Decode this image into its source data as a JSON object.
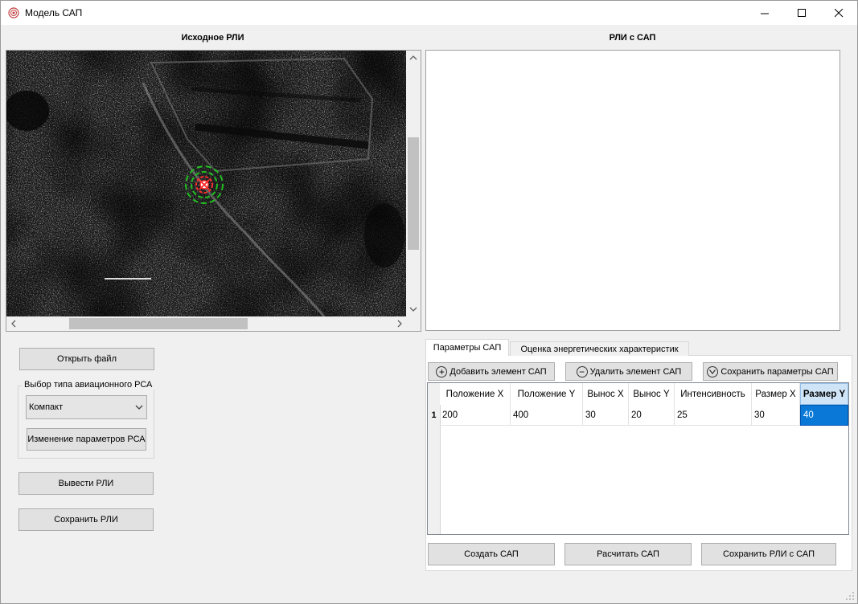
{
  "window": {
    "title": "Модель САП",
    "app_icon": "radar-icon"
  },
  "left": {
    "heading": "Исходное РЛИ",
    "image_icon": "sar-image",
    "open_file": "Открыть файл",
    "group_label": "Выбор типа авиационного РСА",
    "radar_type": "Компакт",
    "change_params": "Изменение параметров РСА",
    "show_image": "Вывести РЛИ",
    "save_image": "Сохранить РЛИ"
  },
  "right": {
    "heading": "РЛИ с САП",
    "tabs": [
      {
        "label": "Параметры САП",
        "active": true
      },
      {
        "label": "Оценка энергетических характеристик",
        "active": false
      }
    ],
    "toolbar": {
      "add": "Добавить элемент САП",
      "remove": "Удалить элемент САП",
      "save_params": "Сохранить параметры САП"
    },
    "table": {
      "columns": [
        "Положение X",
        "Положение  Y",
        "Вынос X",
        "Вынос Y",
        "Интенсивность",
        "Размер X",
        "Размер Y"
      ],
      "rows": [
        {
          "num": "1",
          "cells": [
            "200",
            "400",
            "30",
            "20",
            "25",
            "30",
            "40"
          ]
        }
      ]
    },
    "bottom": {
      "create": "Создать САП",
      "calc": "Расчитать САП",
      "save": "Сохранить РЛИ с САП"
    }
  },
  "colors": {
    "selection": "#0a78d7",
    "marker_red": "#ff3030",
    "marker_green": "#22c022"
  }
}
